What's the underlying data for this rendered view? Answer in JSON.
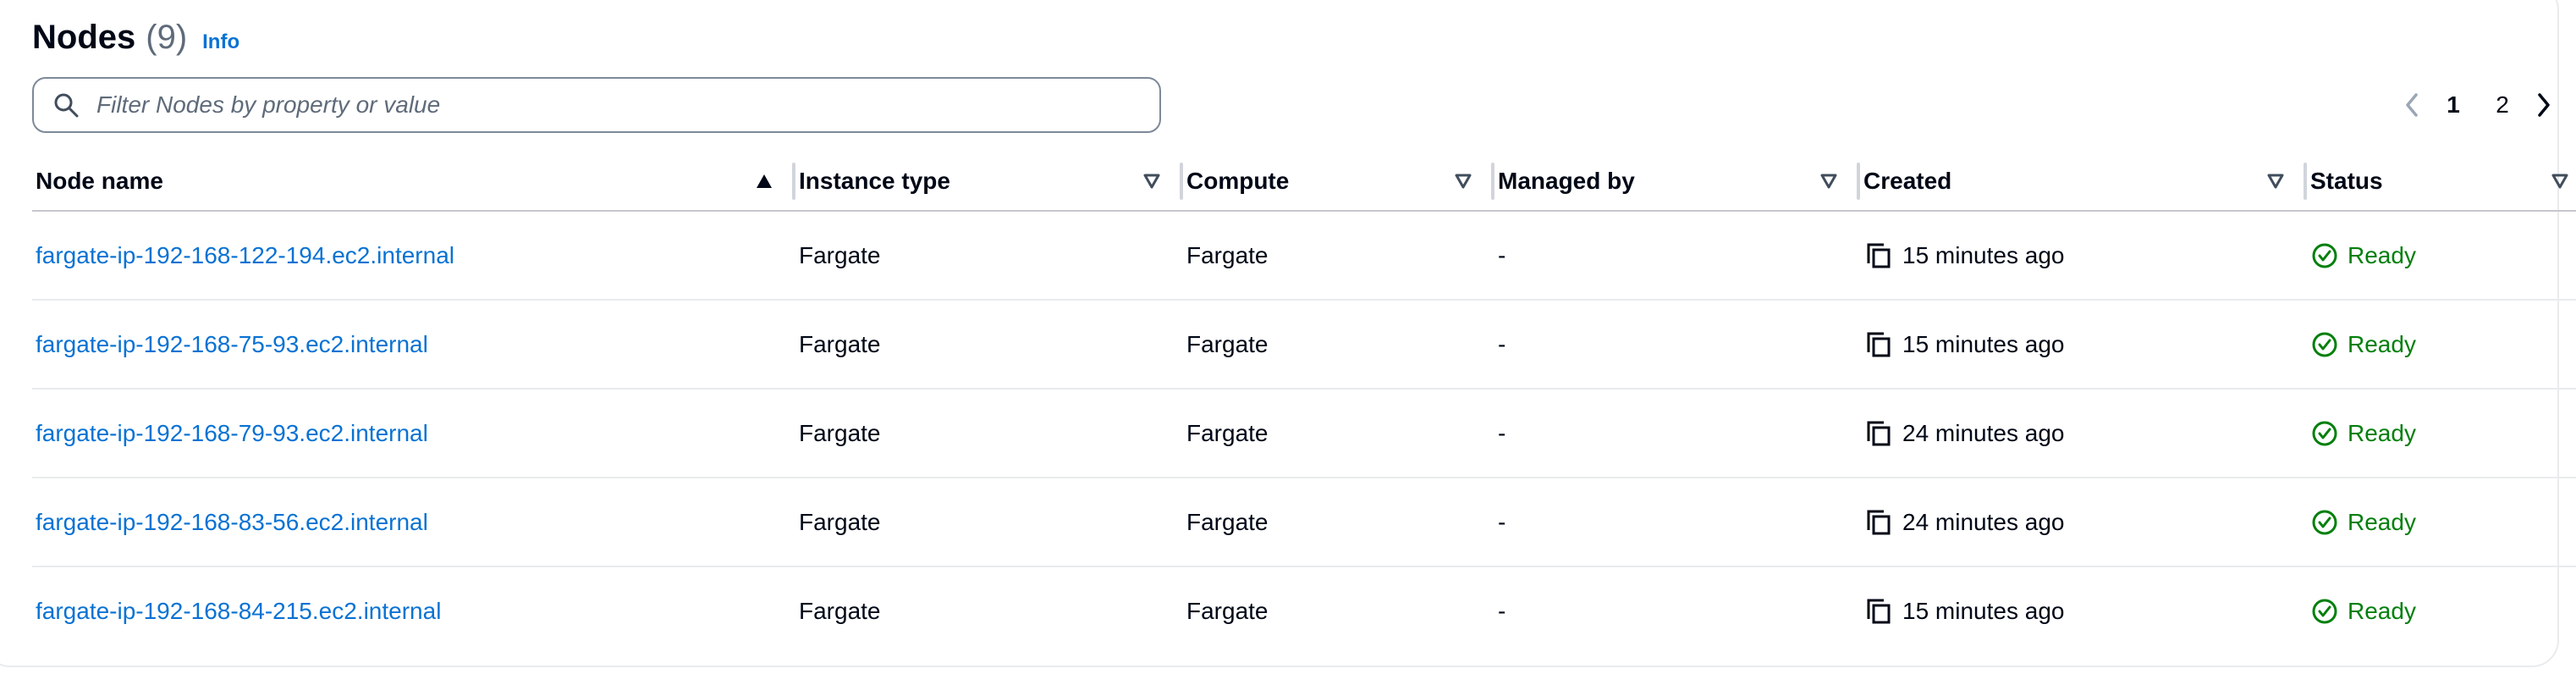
{
  "header": {
    "title": "Nodes",
    "count": "(9)",
    "info_label": "Info"
  },
  "filter": {
    "placeholder": "Filter Nodes by property or value"
  },
  "pagination": {
    "pages": [
      "1",
      "2"
    ],
    "current": "1"
  },
  "columns": [
    "Node name",
    "Instance type",
    "Compute",
    "Managed by",
    "Created",
    "Status"
  ],
  "rows": [
    {
      "name": "fargate-ip-192-168-122-194.ec2.internal",
      "instance_type": "Fargate",
      "compute": "Fargate",
      "managed_by": "-",
      "created": "15 minutes ago",
      "status": "Ready"
    },
    {
      "name": "fargate-ip-192-168-75-93.ec2.internal",
      "instance_type": "Fargate",
      "compute": "Fargate",
      "managed_by": "-",
      "created": "15 minutes ago",
      "status": "Ready"
    },
    {
      "name": "fargate-ip-192-168-79-93.ec2.internal",
      "instance_type": "Fargate",
      "compute": "Fargate",
      "managed_by": "-",
      "created": "24 minutes ago",
      "status": "Ready"
    },
    {
      "name": "fargate-ip-192-168-83-56.ec2.internal",
      "instance_type": "Fargate",
      "compute": "Fargate",
      "managed_by": "-",
      "created": "24 minutes ago",
      "status": "Ready"
    },
    {
      "name": "fargate-ip-192-168-84-215.ec2.internal",
      "instance_type": "Fargate",
      "compute": "Fargate",
      "managed_by": "-",
      "created": "15 minutes ago",
      "status": "Ready"
    }
  ],
  "icons": {
    "search": "search-icon",
    "sort_asc": "sort-ascending-icon",
    "sort": "sort-icon",
    "copy": "copy-icon",
    "status_ok": "status-success-icon",
    "prev": "chevron-left-icon",
    "next": "chevron-right-icon"
  },
  "colors": {
    "link": "#0972d3",
    "success": "#037f0c",
    "text": "#000716",
    "muted": "#5f6b7a"
  }
}
